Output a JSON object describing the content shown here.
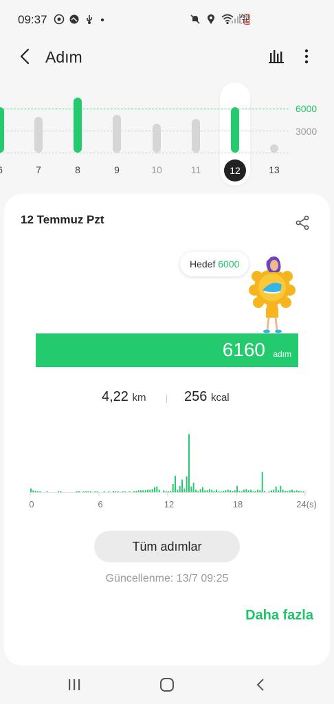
{
  "status": {
    "time": "09:37",
    "left_icons": [
      "whatsapp-icon",
      "gallery-icon",
      "usb-icon",
      "dot-icon"
    ],
    "right_icons": [
      "mute-icon",
      "location-icon",
      "wifi-icon",
      "volte-icon",
      "signal-icon",
      "battery-icon"
    ],
    "volte_label": "Vo)) LTE"
  },
  "header": {
    "title": "Adım",
    "back_icon": "chevron-left-icon",
    "chart_icon": "bar-chart-icon",
    "more_icon": "more-vertical-icon"
  },
  "day_strip": {
    "ref_lines": [
      {
        "label": "6000",
        "value": 6000,
        "color": "#1ec468"
      },
      {
        "label": "3000",
        "value": 3000,
        "color": "#9a9a9a"
      }
    ],
    "days": [
      {
        "label": "6",
        "steps": 6200,
        "goal_met": true,
        "muted": false
      },
      {
        "label": "7",
        "steps": 4900,
        "goal_met": false,
        "muted": false
      },
      {
        "label": "8",
        "steps": 7500,
        "goal_met": true,
        "muted": false
      },
      {
        "label": "9",
        "steps": 5200,
        "goal_met": false,
        "muted": false
      },
      {
        "label": "10",
        "steps": 3900,
        "goal_met": false,
        "muted": true
      },
      {
        "label": "11",
        "steps": 4600,
        "goal_met": false,
        "muted": true
      },
      {
        "label": "12",
        "steps": 6160,
        "goal_met": true,
        "muted": false,
        "selected": true
      },
      {
        "label": "13",
        "steps": 0,
        "goal_met": false,
        "muted": false
      }
    ],
    "axis_max": 8000,
    "colors": {
      "goal_met": "#23cb6e",
      "below_goal": "#d6d6d6"
    }
  },
  "card": {
    "date": "12 Temmuz Pzt",
    "share_icon": "share-icon",
    "goal_label": "Hedef",
    "goal_value": "6000",
    "mascot_icon": "sun-mascot-icon",
    "steps_value": "6160",
    "steps_unit": "adım",
    "steps_fraction_of_goal": 1.0,
    "distance_value": "4,22",
    "distance_unit": "km",
    "calories_value": "256",
    "calories_unit": "kcal",
    "all_steps_button": "Tüm adımlar",
    "updated_text": "Güncellenme: 13/7 09:25",
    "more_link": "Daha fazla"
  },
  "chart_data": {
    "type": "bar",
    "x_tick_labels": [
      "0",
      "6",
      "12",
      "18",
      "24(s)"
    ],
    "x_ticks": [
      0,
      6,
      12,
      18,
      24
    ],
    "xlim": [
      0,
      24
    ],
    "ylim": [
      0,
      100
    ],
    "color": "#23cb6e",
    "grid": false,
    "values": [
      6,
      3,
      2,
      1,
      1,
      0,
      0,
      1,
      0,
      0,
      0,
      0,
      1,
      1,
      0,
      0,
      0,
      0,
      0,
      0,
      1,
      1,
      0,
      1,
      1,
      1,
      1,
      0,
      1,
      1,
      0,
      0,
      1,
      0,
      1,
      0,
      2,
      1,
      1,
      0,
      1,
      1,
      0,
      1,
      0,
      1,
      2,
      3,
      3,
      3,
      3,
      4,
      4,
      5,
      8,
      9,
      4,
      0,
      3,
      1,
      1,
      2,
      13,
      26,
      4,
      10,
      20,
      6,
      25,
      92,
      9,
      15,
      4,
      2,
      5,
      8,
      3,
      3,
      5,
      4,
      2,
      4,
      1,
      1,
      2,
      3,
      4,
      3,
      2,
      3,
      10,
      2,
      1,
      4,
      5,
      3,
      4,
      1,
      2,
      4,
      3,
      32,
      2,
      0,
      1,
      3,
      4,
      9,
      3,
      10,
      4,
      2,
      2,
      3,
      4,
      2,
      3,
      2,
      1,
      1
    ]
  },
  "nav": {
    "recents_icon": "recents-icon",
    "home_icon": "home-icon",
    "back_icon": "back-icon"
  }
}
